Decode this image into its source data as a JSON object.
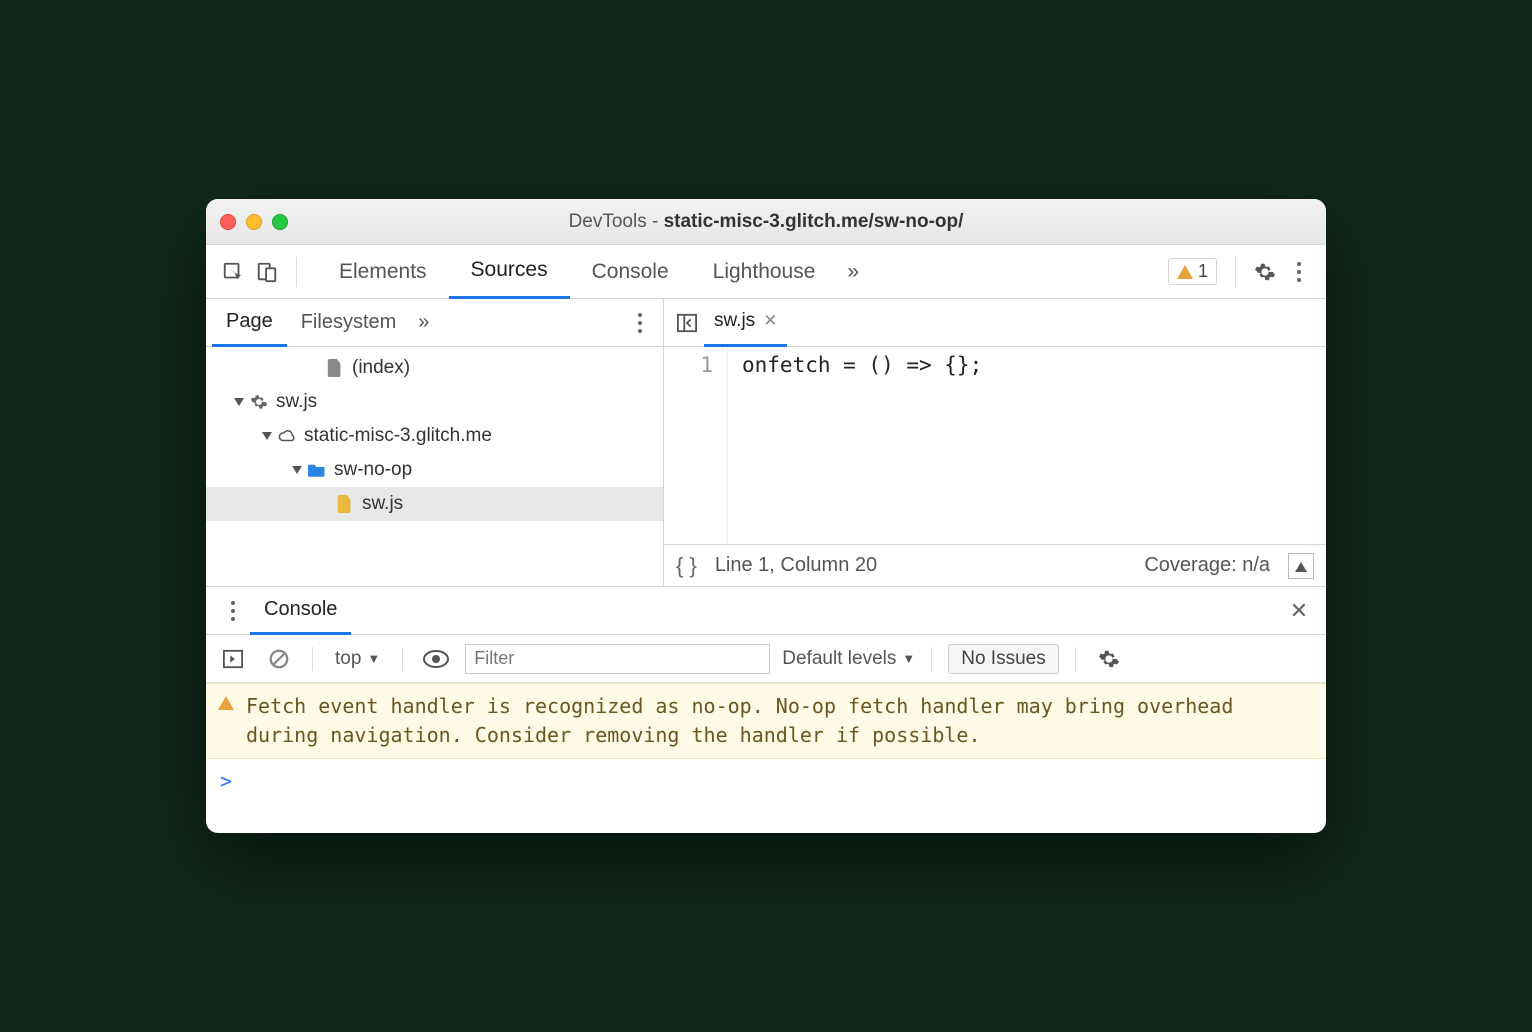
{
  "window": {
    "title_prefix": "DevTools - ",
    "title_bold": "static-misc-3.glitch.me/sw-no-op/"
  },
  "toolbar": {
    "tabs": [
      "Elements",
      "Sources",
      "Console",
      "Lighthouse"
    ],
    "active_tab": "Sources",
    "more": "»",
    "warning_count": "1"
  },
  "sources": {
    "nav_tabs": [
      "Page",
      "Filesystem"
    ],
    "nav_more": "»",
    "tree": {
      "index_label": "(index)",
      "worker_label": "sw.js",
      "domain_label": "static-misc-3.glitch.me",
      "folder_label": "sw-no-op",
      "file_label": "sw.js"
    },
    "open_file": "sw.js",
    "code": {
      "line_no": "1",
      "text": "onfetch = () => {};"
    },
    "status": {
      "pos": "Line 1, Column 20",
      "coverage": "Coverage: n/a"
    }
  },
  "drawer": {
    "tab": "Console"
  },
  "console": {
    "context": "top",
    "filter_placeholder": "Filter",
    "levels": "Default levels",
    "issues_btn": "No Issues",
    "warning": "Fetch event handler is recognized as no-op. No-op fetch handler may bring overhead during navigation. Consider removing the handler if possible.",
    "prompt": ">"
  }
}
